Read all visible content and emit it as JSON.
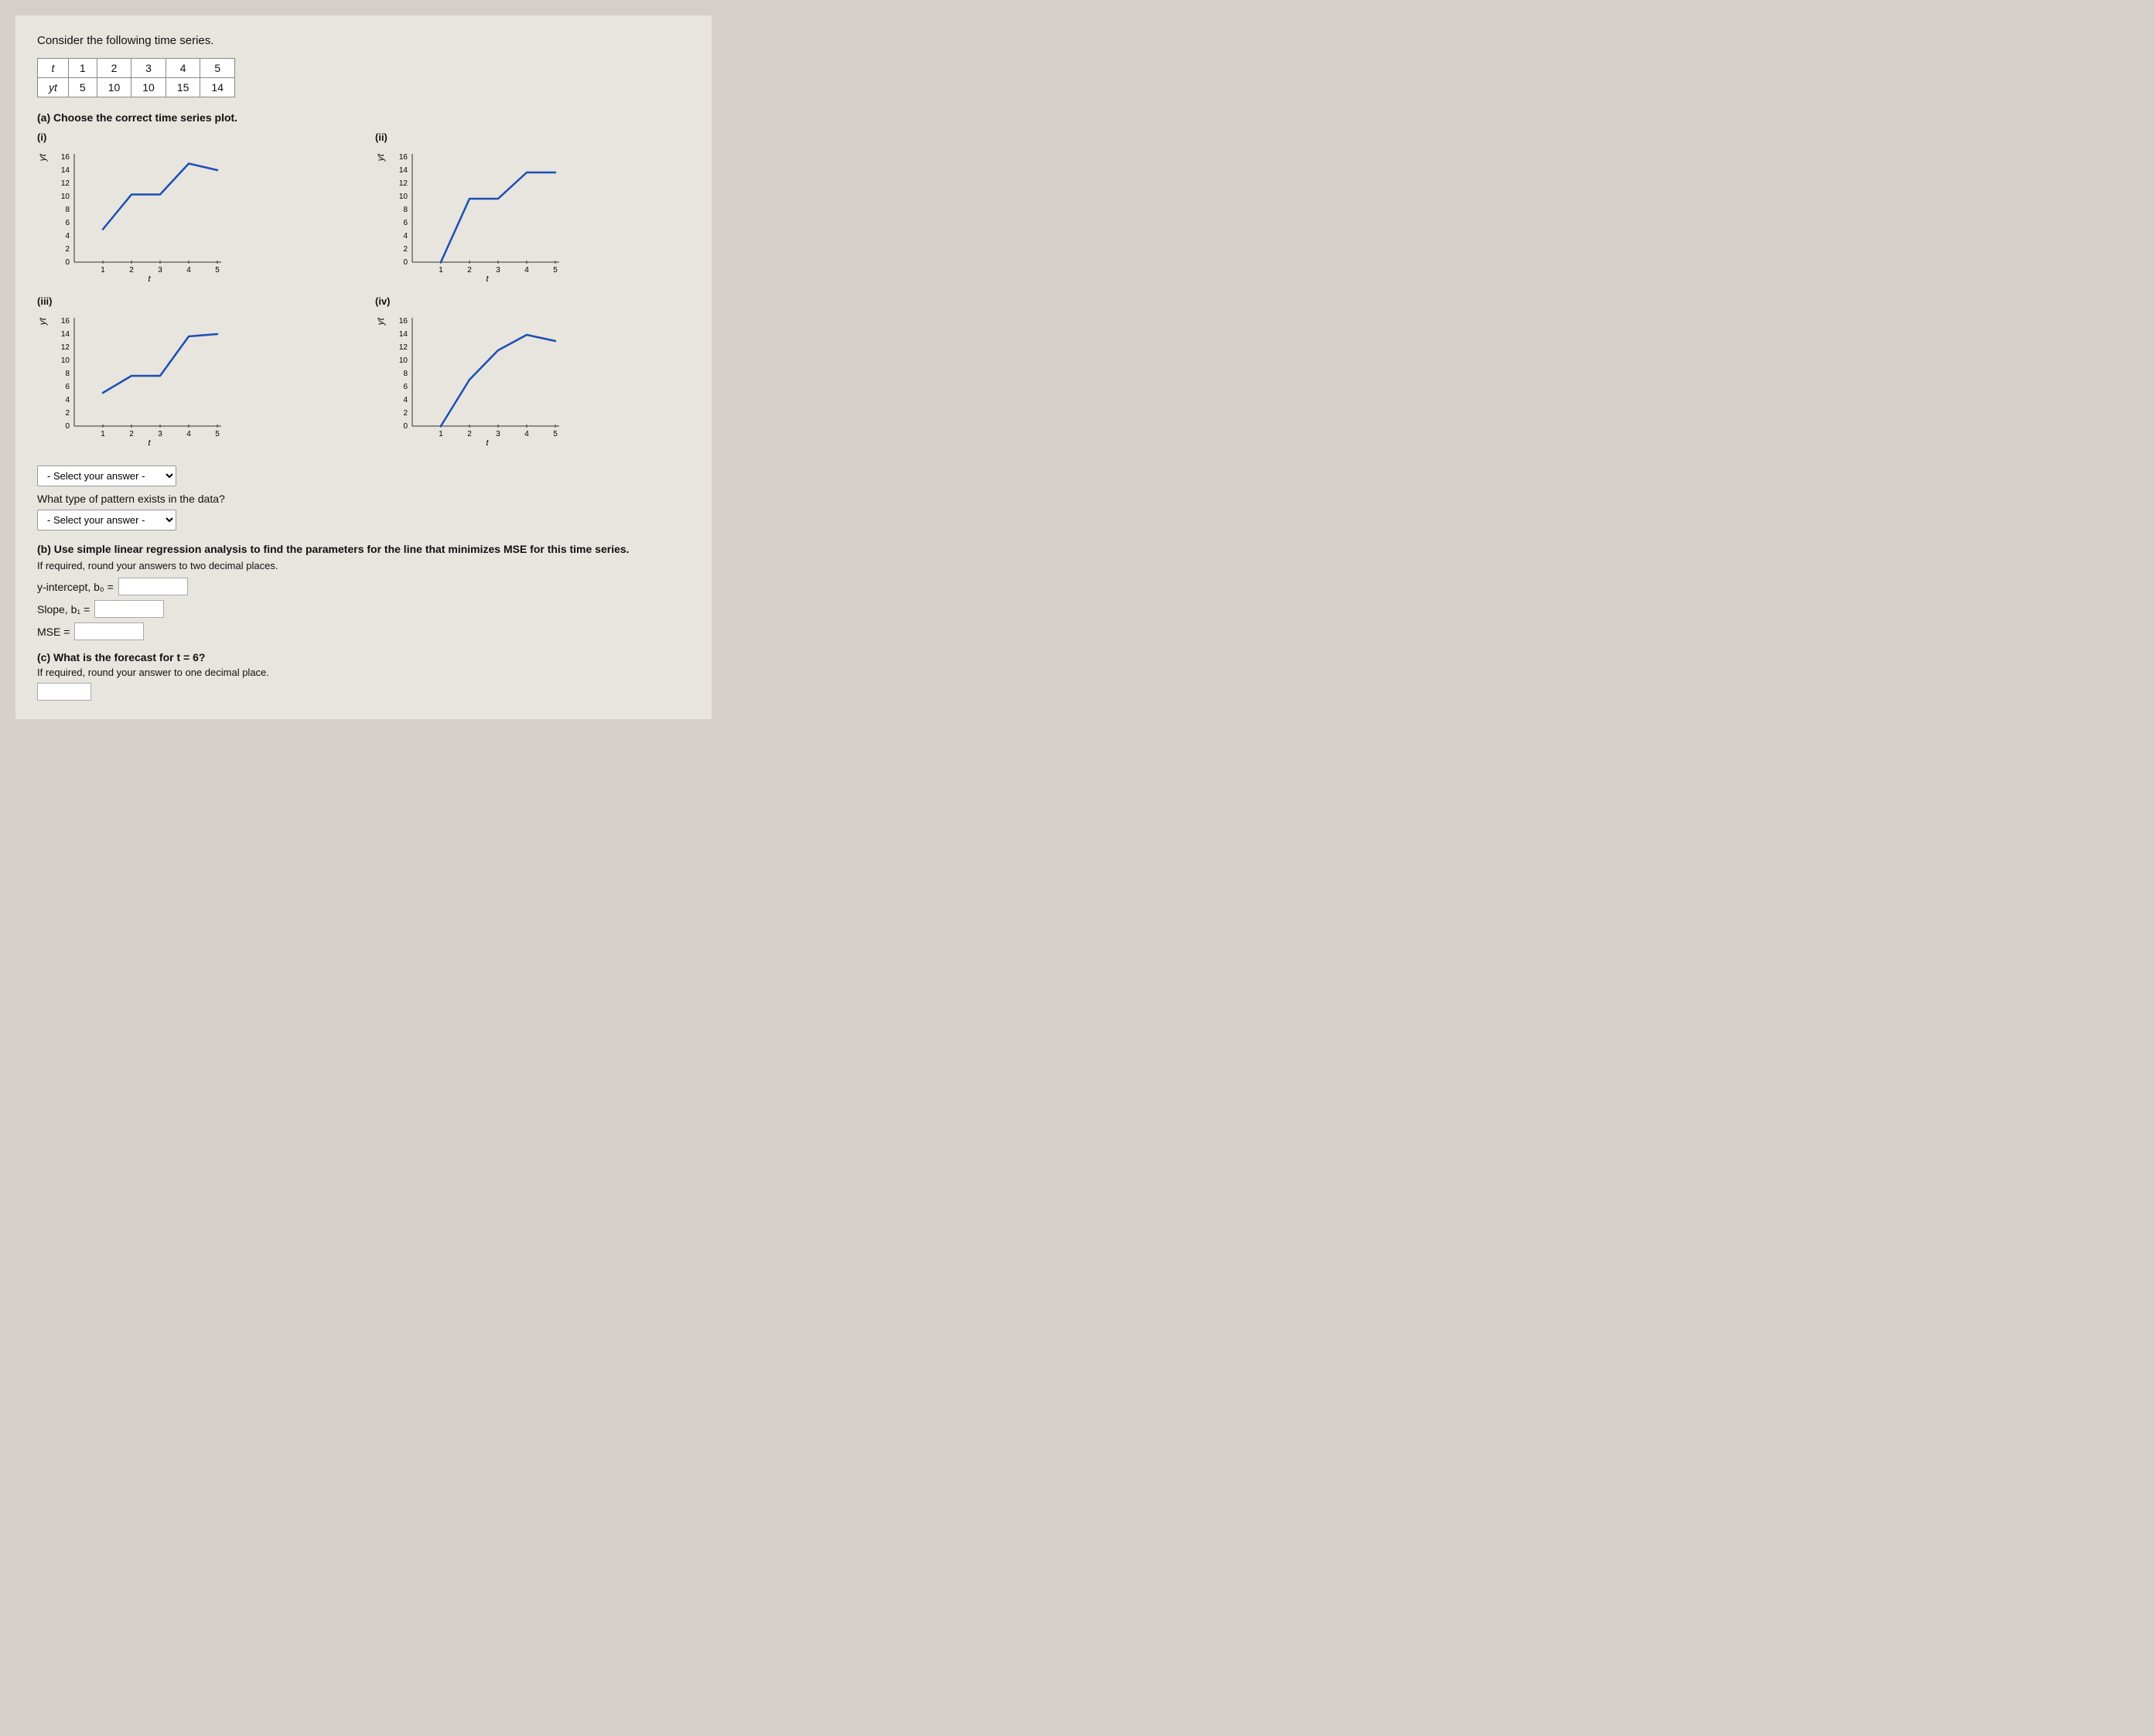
{
  "page": {
    "title": "Consider the following time series.",
    "table": {
      "headers": [
        "t",
        "1",
        "2",
        "3",
        "4",
        "5"
      ],
      "row_label": "yt",
      "row_values": [
        "5",
        "10",
        "10",
        "15",
        "14"
      ]
    },
    "part_a": {
      "label": "(a) Choose the correct time series plot.",
      "plots": [
        {
          "id": "i",
          "label": "(i)",
          "curve_type": "curve_flat_top",
          "y_axis_values": [
            "16",
            "14",
            "12",
            "10",
            "8",
            "6",
            "4",
            "2",
            "0"
          ],
          "x_axis_values": [
            "1",
            "2",
            "3",
            "4",
            "5"
          ],
          "x_label": "t",
          "y_label": "yt"
        },
        {
          "id": "ii",
          "label": "(ii)",
          "curve_type": "curve_stepped",
          "y_axis_values": [
            "16",
            "14",
            "12",
            "10",
            "8",
            "6",
            "4",
            "2",
            "0"
          ],
          "x_axis_values": [
            "1",
            "2",
            "3",
            "4",
            "5"
          ],
          "x_label": "t",
          "y_label": "yt"
        },
        {
          "id": "iii",
          "label": "(iii)",
          "curve_type": "curve_gradual",
          "y_axis_values": [
            "16",
            "14",
            "12",
            "10",
            "8",
            "6",
            "4",
            "2",
            "0"
          ],
          "x_axis_values": [
            "1",
            "2",
            "3",
            "4",
            "5"
          ],
          "x_label": "t",
          "y_label": "yt"
        },
        {
          "id": "iv",
          "label": "(iv)",
          "curve_type": "curve_peak",
          "y_axis_values": [
            "16",
            "14",
            "12",
            "10",
            "8",
            "6",
            "4",
            "2",
            "0"
          ],
          "x_axis_values": [
            "1",
            "2",
            "3",
            "4",
            "5"
          ],
          "x_label": "t",
          "y_label": "yt"
        }
      ],
      "select_placeholder": "- Select your answer -",
      "what_type_label": "What type of pattern exists in the data?",
      "select2_placeholder": "- Select your answer -"
    },
    "part_b": {
      "title": "(b) Use simple linear regression analysis to find the parameters for the line that minimizes MSE for this time series.",
      "subtitle": "If required, round your answers to two decimal places.",
      "y_intercept_label": "y-intercept, b₀ =",
      "slope_label": "Slope, b₁ =",
      "mse_label": "MSE ="
    },
    "part_c": {
      "title": "(c) What is the forecast for t = 6?",
      "subtitle": "If required, round your answer to one decimal place."
    }
  }
}
